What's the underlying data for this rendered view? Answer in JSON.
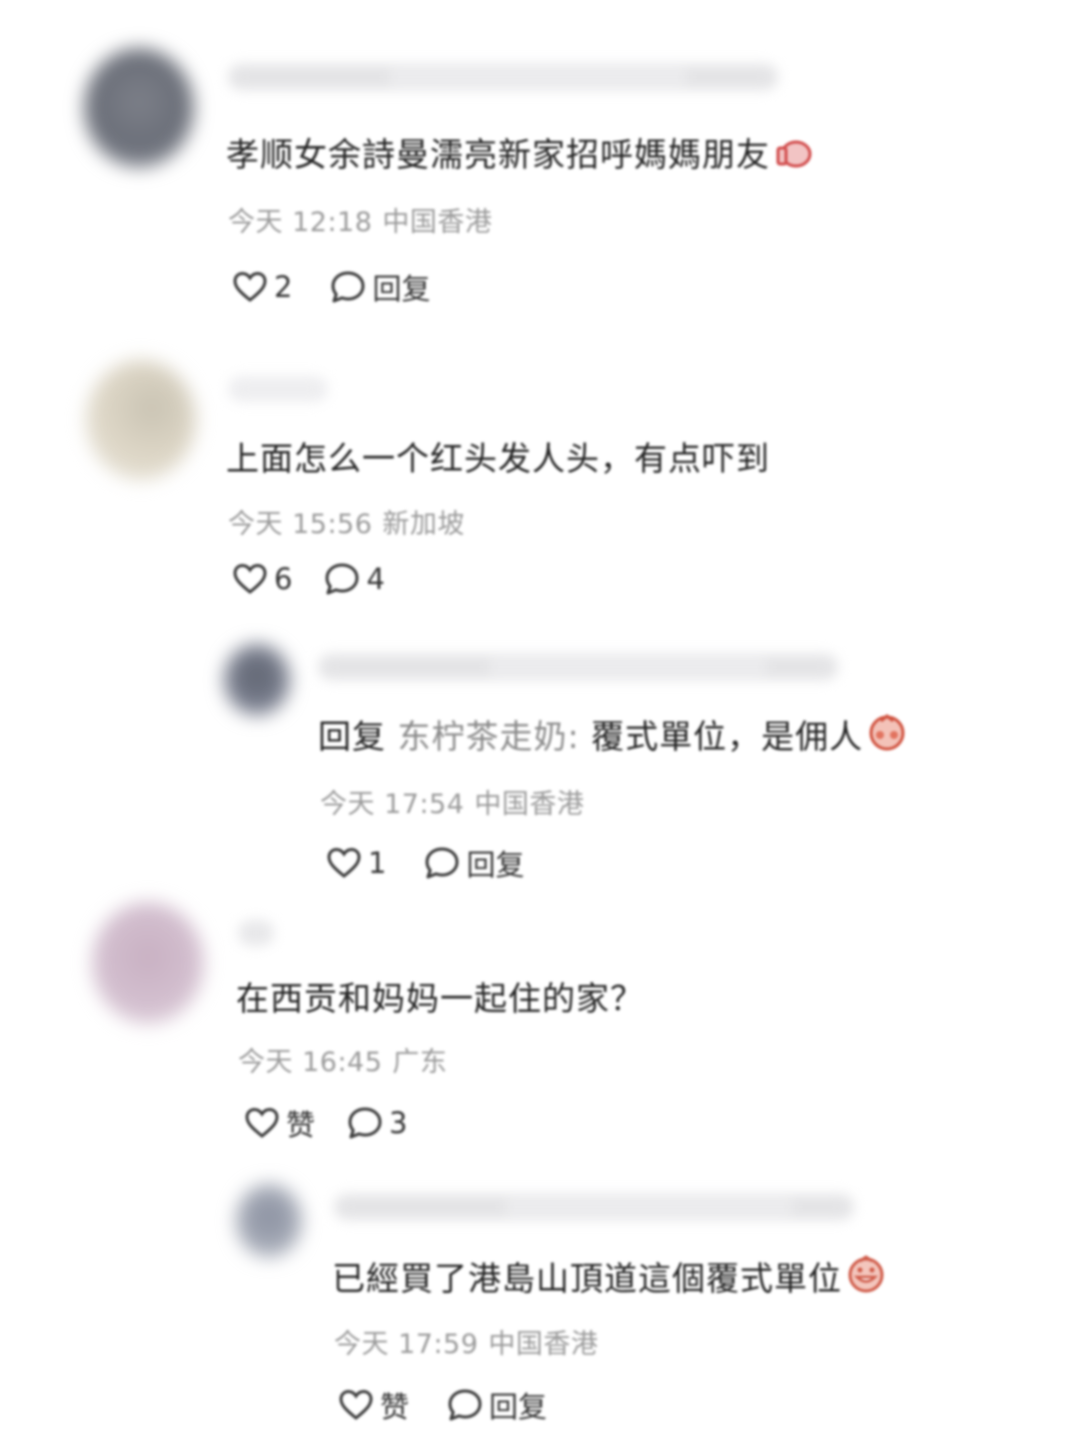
{
  "comments": [
    {
      "text": "孝顺女余詩曼濡亮新家招呼媽媽朋友",
      "time": "今天 12:18",
      "location": "中国香港",
      "likes": "2",
      "reply_label": "回复"
    },
    {
      "text": "上面怎么一个红头发人头，有点吓到",
      "time": "今天 15:56",
      "location": "新加坡",
      "likes": "6",
      "reply_count": "4"
    },
    {
      "reply_prefix": "回复",
      "mention": "东柠茶走奶:",
      "text": "覆式單位，是佣人",
      "time": "今天 17:54",
      "location": "中国香港",
      "likes": "1",
      "reply_label": "回复"
    },
    {
      "text": "在西贡和妈妈一起住的家？",
      "time": "今天 16:45",
      "location": "广东",
      "like_label": "赞",
      "reply_count": "3"
    },
    {
      "text": "已經買了港島山頂道這個覆式單位",
      "time": "今天 17:59",
      "location": "中国香港",
      "like_label": "赞",
      "reply_label": "回复"
    }
  ],
  "icons": {
    "like": "heart-outline-icon",
    "reply": "speech-bubble-outline-icon"
  },
  "colors": {
    "text": "#222222",
    "meta": "#9a9a9a",
    "mention": "#8a8a8a"
  }
}
